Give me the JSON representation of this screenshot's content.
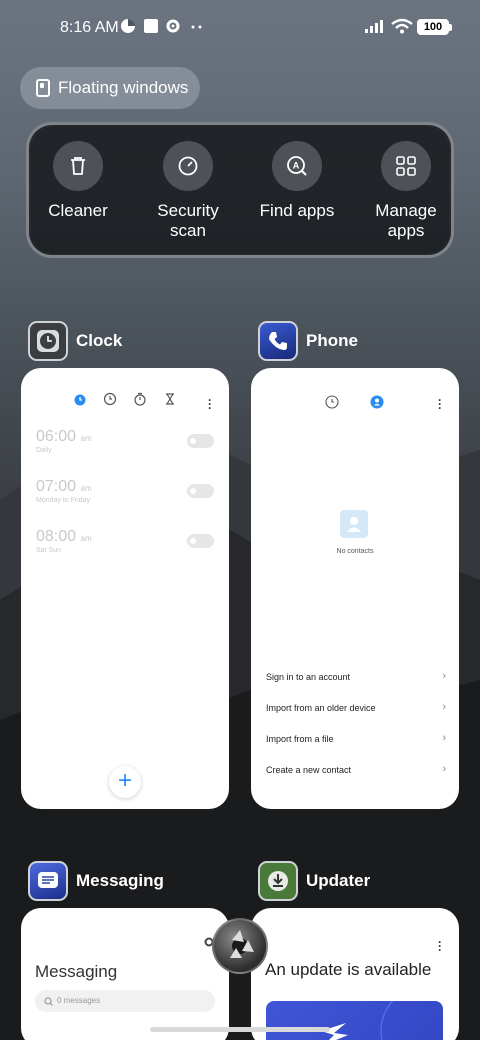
{
  "status_bar": {
    "time": "8:16 AM",
    "battery": "100",
    "icons": [
      "data-saver-icon",
      "square-notification-icon",
      "gear-icon",
      "more-dots-icon",
      "signal-icon",
      "wifi-icon",
      "battery-icon"
    ]
  },
  "floating_windows": {
    "label": "Floating windows",
    "icon": "floating-window-icon"
  },
  "quick_actions": [
    {
      "label1": "Cleaner",
      "label2": "",
      "icon": "trash-icon"
    },
    {
      "label1": "Security",
      "label2": "scan",
      "icon": "security-scan-icon"
    },
    {
      "label1": "Find apps",
      "label2": "",
      "icon": "app-search-icon"
    },
    {
      "label1": "Manage",
      "label2": "apps",
      "icon": "grid-icon"
    }
  ],
  "apps": {
    "clock": {
      "name": "Clock",
      "alarms": [
        {
          "time": "06:00",
          "ampm": "am",
          "repeat": "Daily",
          "enabled": false
        },
        {
          "time": "07:00",
          "ampm": "am",
          "repeat": "Monday to Friday",
          "enabled": false
        },
        {
          "time": "08:00",
          "ampm": "am",
          "repeat": "Sat Sun",
          "enabled": false
        }
      ],
      "fab": "+"
    },
    "phone": {
      "name": "Phone",
      "empty_text": "No contacts",
      "options": [
        "Sign in to an account",
        "Import from an older device",
        "Import from a file",
        "Create a new contact"
      ]
    },
    "messaging": {
      "name": "Messaging",
      "title": "Messaging",
      "search_placeholder": "0 messages"
    },
    "updater": {
      "name": "Updater",
      "title": "An update is available"
    }
  },
  "colors": {
    "accent_blue": "#2a8cf0",
    "card_bg": "#ffffff",
    "panel_bg": "#16181b"
  }
}
